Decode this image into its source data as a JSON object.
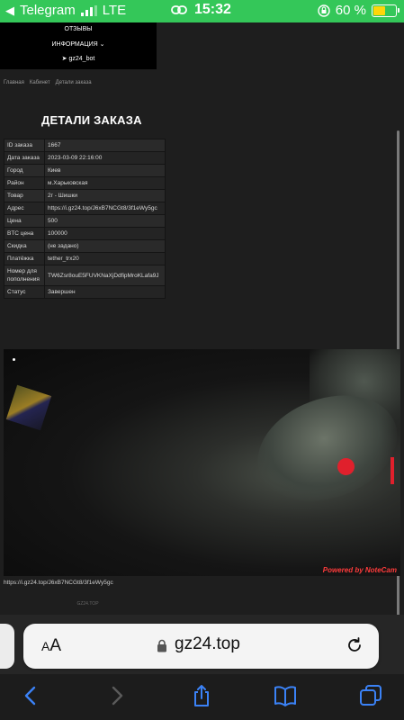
{
  "status_bar": {
    "carrier": "Telegram",
    "network": "LTE",
    "time": "15:32",
    "battery_percent": "60 %",
    "battery_level": 0.6
  },
  "top_menu": {
    "items": [
      "ОТЗЫВЫ",
      "ИНФОРМАЦИЯ ⌄",
      "gz24_bot"
    ]
  },
  "breadcrumb": [
    "Главная",
    "Кабинет",
    "Детали заказа"
  ],
  "page_title": "ДЕТАЛИ ЗАКАЗА",
  "order_details": [
    {
      "key": "ID заказа",
      "value": "1667"
    },
    {
      "key": "Дата заказа",
      "value": "2023-03-09 22:16:00"
    },
    {
      "key": "Город",
      "value": "Киев"
    },
    {
      "key": "Район",
      "value": "м.Харьковская"
    },
    {
      "key": "Товар",
      "value": "2г - Шишки"
    },
    {
      "key": "Адрес",
      "value": "https://i.gz24.top/J6xB7NCGt8/3f1eWy5gc"
    },
    {
      "key": "Цена",
      "value": "500"
    },
    {
      "key": "BTC цена",
      "value": "100000"
    },
    {
      "key": "Скидка",
      "value": "(не задано)"
    },
    {
      "key": "Платёжка",
      "value": "tether_trx20"
    },
    {
      "key": "Номер для пополнения",
      "value": "TW6Zsr8ouE5FUVKNaXjDdfipMroKLafa9J"
    },
    {
      "key": "Статус",
      "value": "Завершен"
    }
  ],
  "photo": {
    "watermark": "Powered by NoteCam",
    "url": "https://i.gz24.top/J6xB7NCGt8/3f1eWy5gc"
  },
  "footer": "GZ24.TOP",
  "safari": {
    "text_size_label_small": "A",
    "text_size_label_big": "A",
    "url": "gz24.top",
    "icons": [
      "back-icon",
      "forward-icon",
      "share-icon",
      "bookmarks-icon",
      "tabs-icon",
      "reload-icon",
      "lock-icon"
    ]
  }
}
